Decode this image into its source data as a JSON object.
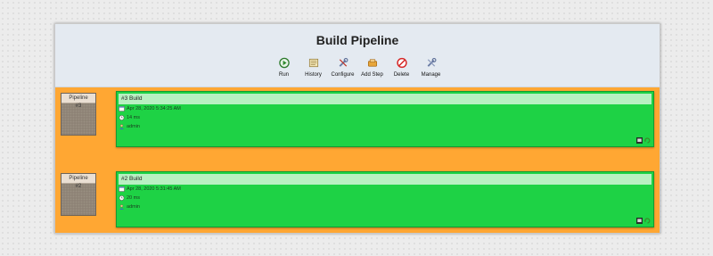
{
  "page": {
    "title": "Build Pipeline"
  },
  "toolbar": [
    {
      "label": "Run",
      "icon": "run-icon"
    },
    {
      "label": "History",
      "icon": "history-icon"
    },
    {
      "label": "Configure",
      "icon": "configure-icon"
    },
    {
      "label": "Add Step",
      "icon": "add-step-icon"
    },
    {
      "label": "Delete",
      "icon": "delete-icon"
    },
    {
      "label": "Manage",
      "icon": "manage-icon"
    }
  ],
  "pipelines": [
    {
      "pipeline_label": "Pipeline",
      "pipeline_number": "#3",
      "build_title": "#3 Build",
      "date": "Apr 28, 2020 5:34:25 AM",
      "duration": "14 ms",
      "user": "admin"
    },
    {
      "pipeline_label": "Pipeline",
      "pipeline_number": "#2",
      "build_title": "#2 Build",
      "date": "Apr 28, 2020 5:31:45 AM",
      "duration": "20 ms",
      "user": "admin"
    }
  ],
  "colors": {
    "panel_bg": "#ffa733",
    "header_bg": "#e4eaf1",
    "build_success": "#1ed245",
    "build_header": "#b8f0c2",
    "pipeline_card": "#8b8073"
  }
}
